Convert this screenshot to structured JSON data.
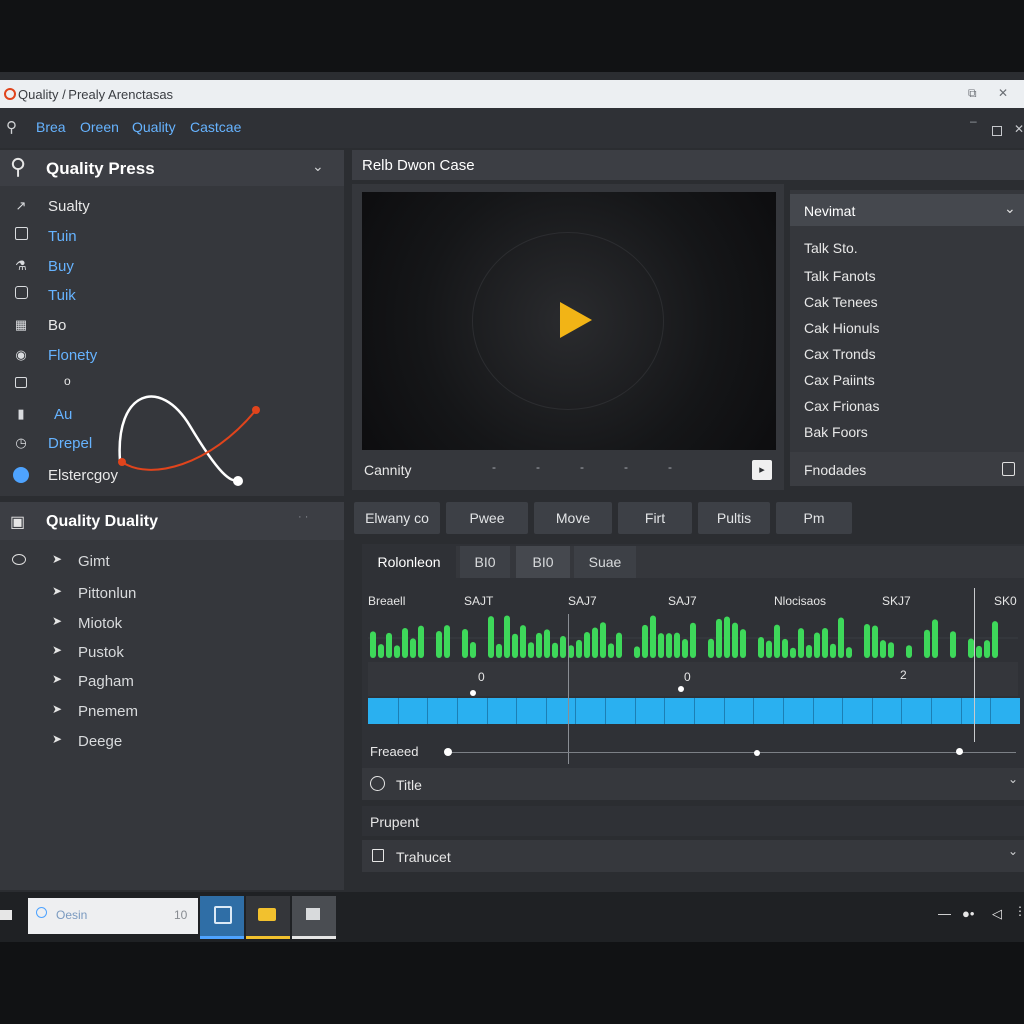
{
  "window": {
    "title": "Quality / Prealy  Arenctasas"
  },
  "menu": [
    "Brea",
    "Oreen",
    "Quality",
    "Castcae"
  ],
  "left_panel": {
    "title": "Quality Press",
    "items": [
      {
        "label": "Sualty",
        "icon": "chart-icon",
        "highlight": false
      },
      {
        "label": "Tuin",
        "icon": "square-icon",
        "highlight": true
      },
      {
        "label": "Buy",
        "icon": "link-icon",
        "highlight": true
      },
      {
        "label": "Tuik",
        "icon": "target-icon",
        "highlight": true
      },
      {
        "label": "Bo",
        "icon": "grid-icon",
        "highlight": false
      },
      {
        "label": "Flonety",
        "icon": "badge-icon",
        "highlight": true
      },
      {
        "label": "o",
        "icon": "frame-icon",
        "highlight": false
      },
      {
        "label": "Au",
        "icon": "phone-icon",
        "highlight": true
      },
      {
        "label": "Drepel",
        "icon": "clock-icon",
        "highlight": true
      },
      {
        "label": "Elstercgoy",
        "icon": "circle-icon",
        "highlight": false
      }
    ]
  },
  "tree_panel": {
    "title": "Quality Duality",
    "items": [
      "Gimt",
      "Pittonlun",
      "Miotok",
      "Pustok",
      "Pagham",
      "Pnemem",
      "Deege"
    ]
  },
  "center": {
    "title": "Relb Dwon Case",
    "video_label": "Cannity"
  },
  "right_panel": {
    "dropdown": "Nevimat",
    "items": [
      "Talk Sto.",
      "Talk Fanots",
      "Cak Tenees",
      "Cak Hionuls",
      "Cax Tronds",
      "Cax Paiints",
      "Cax Frionas",
      "Bak Foors"
    ],
    "footer": "Fnodades"
  },
  "toolbar": [
    "Elwany co",
    "Pwee",
    "Move",
    "Firt",
    "Pultis",
    "Pm"
  ],
  "subtabs": [
    "Rolonleon",
    "BI0",
    "BI0",
    "Suae"
  ],
  "timeline": {
    "labels": [
      "Breaell",
      "SAJT",
      "SAJ7",
      "SAJ7",
      "Nlocisaos",
      "SKJ7",
      "SK0"
    ],
    "markers": [
      "0",
      "0",
      "2"
    ],
    "progress_label": "Freaeed",
    "progress": 0.9
  },
  "sections": [
    {
      "label": "Title",
      "icon": "clock-icon"
    },
    {
      "label": "Prupent",
      "icon": ""
    },
    {
      "label": "Trahucet",
      "icon": "doc-icon"
    }
  ],
  "taskbar": {
    "search_placeholder": "Oesin",
    "search_value": "10"
  },
  "colors": {
    "accent": "#4ea3ff",
    "waveform": "#3ed85a",
    "track": "#2ab0f0",
    "play": "#f2b416",
    "curve_red": "#e0441c"
  }
}
